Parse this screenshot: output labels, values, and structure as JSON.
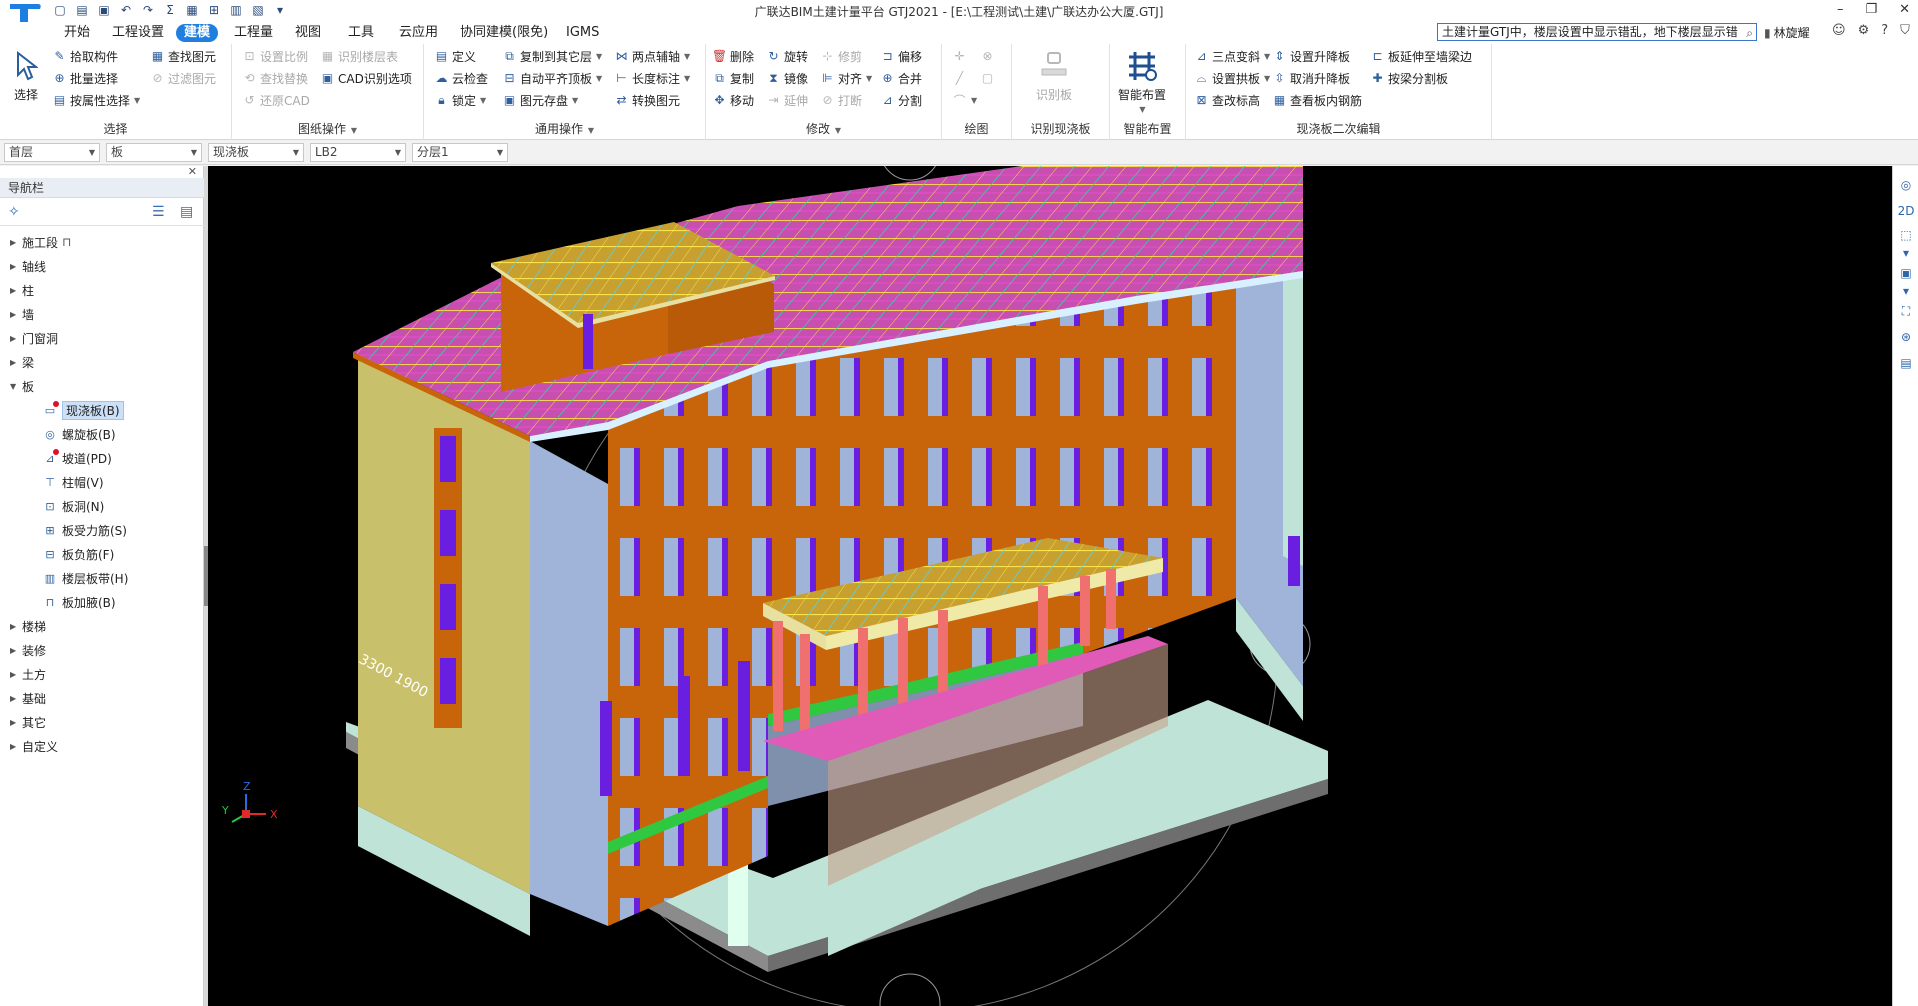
{
  "app": {
    "title": "广联达BIM土建计量平台 GTJ2021 - [E:\\工程测试\\土建\\广联达办公大厦.GTJ]",
    "user": "林旋耀",
    "search_value": "土建计量GTJ中，楼层设置中显示错乱，地下楼层显示错"
  },
  "menu": {
    "tabs": [
      "开始",
      "工程设置",
      "建模",
      "工程量",
      "视图",
      "工具",
      "云应用",
      "协同建模(限免)",
      "IGMS"
    ],
    "active": "建模"
  },
  "ribbon": {
    "select": {
      "label": "选择",
      "big_label": "选择",
      "items": [
        "拾取构件",
        "批量选择",
        "按属性选择",
        "查找图元",
        "过滤图元"
      ]
    },
    "drawing_ops": {
      "label": "图纸操作",
      "items": [
        "设置比例",
        "识别楼层表",
        "查找替换",
        "CAD识别选项",
        "还原CAD"
      ]
    },
    "general_ops": {
      "label": "通用操作",
      "items": [
        "定义",
        "复制到其它层",
        "两点辅轴",
        "云检查",
        "自动平齐顶板",
        "长度标注",
        "锁定",
        "图元存盘",
        "转换图元"
      ]
    },
    "modify": {
      "label": "修改",
      "items": [
        "删除",
        "旋转",
        "修剪",
        "偏移",
        "复制",
        "镜像",
        "对齐",
        "合并",
        "移动",
        "延伸",
        "打断",
        "分割"
      ]
    },
    "draw": {
      "label": "绘图"
    },
    "recognize": {
      "label": "识别现浇板",
      "big_label": "识别板"
    },
    "smart": {
      "label": "智能布置",
      "big_label": "智能布置"
    },
    "slab_edit": {
      "label": "现浇板二次编辑",
      "items": [
        "三点变斜",
        "设置升降板",
        "板延伸至墙梁边",
        "设置拱板",
        "取消升降板",
        "按梁分割板",
        "查改标高",
        "查看板内钢筋"
      ]
    }
  },
  "layerbar": {
    "floor": "首层",
    "category": "板",
    "type": "现浇板",
    "component": "LB2",
    "sublayer": "分层1"
  },
  "nav": {
    "title": "导航栏",
    "nodes": [
      "施工段",
      "轴线",
      "柱",
      "墙",
      "门窗洞",
      "梁",
      "板"
    ],
    "slab_children": [
      "现浇板(B)",
      "螺旋板(B)",
      "坡道(PD)",
      "柱帽(V)",
      "板洞(N)",
      "板受力筋(S)",
      "板负筋(F)",
      "楼层板带(H)",
      "板加腋(B)"
    ],
    "nodes_after": [
      "楼梯",
      "装修",
      "土方",
      "基础",
      "其它",
      "自定义"
    ]
  },
  "viewport": {
    "dimension_label": "3300 1900",
    "axes": {
      "x": "X",
      "y": "Y",
      "z": "Z"
    }
  },
  "colors": {
    "accent": "#1e7fe0",
    "slab": "#c64fb0",
    "wall": "#c8640a",
    "column": "#7a1ee0",
    "side_wall": "#c8c06a",
    "glass": "#9fb4d8"
  }
}
